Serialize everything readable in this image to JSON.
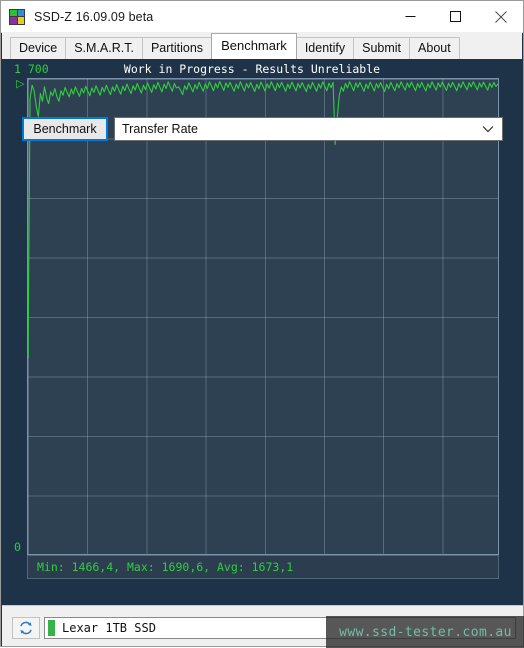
{
  "window": {
    "title": "SSD-Z 16.09.09 beta",
    "icon": "ssdz-app-icon",
    "controls": {
      "minimize": "minimize-icon",
      "maximize": "maximize-icon",
      "close": "close-icon"
    }
  },
  "tabs": [
    {
      "label": "Device",
      "active": false
    },
    {
      "label": "S.M.A.R.T.",
      "active": false
    },
    {
      "label": "Partitions",
      "active": false
    },
    {
      "label": "Benchmark",
      "active": true
    },
    {
      "label": "Identify",
      "active": false
    },
    {
      "label": "Submit",
      "active": false
    },
    {
      "label": "About",
      "active": false
    }
  ],
  "chart_data": {
    "type": "line",
    "title": "Work in Progress - Results Unreliable",
    "xlabel": "",
    "ylabel": "",
    "ylim": [
      0,
      1700
    ],
    "y_tick_labels": [
      "1 700",
      "0"
    ],
    "grid": true,
    "legend": false,
    "series_color": "#2ecf3e",
    "background": "#2e4152",
    "marker": "▷",
    "stats": {
      "min": "1466,4",
      "max": "1690,6",
      "avg": "1673,1",
      "text": "Min: 1466,4, Max: 1690,6, Avg: 1673,1"
    },
    "x": [
      0,
      1,
      2,
      3,
      4,
      5,
      6,
      7,
      8,
      9,
      10,
      11,
      12,
      13,
      14,
      15,
      16,
      17,
      18,
      19,
      20,
      21,
      22,
      23,
      24,
      25,
      26,
      27,
      28,
      29,
      30,
      31,
      32,
      33,
      34,
      35,
      36,
      37,
      38,
      39,
      40,
      41,
      42,
      43,
      44,
      45,
      46,
      47,
      48,
      49,
      50,
      51,
      52,
      53,
      54,
      55,
      56,
      57,
      58,
      59,
      60,
      61,
      62,
      63,
      64,
      65,
      66,
      67,
      68,
      69,
      70,
      71,
      72,
      73,
      74,
      75,
      76,
      77,
      78,
      79,
      80,
      81,
      82,
      83,
      84,
      85,
      86,
      87,
      88,
      89,
      90,
      91,
      92,
      93,
      94,
      95,
      96,
      97,
      98,
      99,
      100,
      101,
      102,
      103,
      104,
      105,
      106,
      107,
      108,
      109,
      110,
      111,
      112,
      113,
      114,
      115,
      116,
      117,
      118,
      119,
      120,
      121,
      122,
      123,
      124,
      125,
      126,
      127,
      128,
      129,
      130,
      131,
      132,
      133,
      134,
      135,
      136,
      137,
      138,
      139,
      140,
      141,
      142,
      143,
      144,
      145,
      146,
      147,
      148,
      149,
      150,
      151,
      152,
      153,
      154,
      155,
      156,
      157,
      158,
      159,
      160,
      161,
      162,
      163,
      164,
      165,
      166,
      167,
      168,
      169,
      170,
      171,
      172,
      173,
      174,
      175,
      176,
      177,
      178,
      179,
      180,
      181,
      182,
      183,
      184,
      185,
      186,
      187,
      188,
      189,
      190,
      191,
      192,
      193,
      194,
      195,
      196,
      197,
      198,
      199,
      200,
      201,
      202,
      203,
      204,
      205,
      206,
      207,
      208,
      209,
      210,
      211,
      212,
      213,
      214,
      215,
      216,
      217,
      218,
      219,
      220,
      221,
      222,
      223,
      224,
      225,
      226,
      227,
      228,
      229,
      230,
      231,
      232,
      233
    ],
    "values": [
      700,
      1630,
      1678,
      1656,
      1602,
      1566,
      1648,
      1620,
      1672,
      1634,
      1612,
      1654,
      1640,
      1666,
      1638,
      1620,
      1658,
      1642,
      1670,
      1652,
      1636,
      1664,
      1646,
      1672,
      1654,
      1638,
      1666,
      1650,
      1674,
      1656,
      1640,
      1668,
      1652,
      1676,
      1658,
      1642,
      1670,
      1654,
      1678,
      1660,
      1644,
      1672,
      1656,
      1680,
      1662,
      1646,
      1674,
      1658,
      1682,
      1664,
      1648,
      1676,
      1660,
      1684,
      1666,
      1650,
      1678,
      1662,
      1686,
      1668,
      1652,
      1680,
      1664,
      1688,
      1670,
      1654,
      1682,
      1666,
      1690,
      1672,
      1656,
      1684,
      1668,
      1672,
      1660,
      1644,
      1676,
      1662,
      1686,
      1670,
      1654,
      1680,
      1664,
      1688,
      1672,
      1656,
      1682,
      1666,
      1690,
      1674,
      1658,
      1684,
      1668,
      1691,
      1675,
      1659,
      1686,
      1670,
      1688,
      1672,
      1656,
      1682,
      1666,
      1690,
      1673,
      1657,
      1684,
      1668,
      1687,
      1671,
      1655,
      1681,
      1665,
      1689,
      1673,
      1657,
      1683,
      1667,
      1690,
      1674,
      1658,
      1685,
      1669,
      1688,
      1672,
      1656,
      1682,
      1666,
      1689,
      1673,
      1657,
      1684,
      1668,
      1687,
      1671,
      1655,
      1681,
      1665,
      1688,
      1672,
      1656,
      1683,
      1667,
      1690,
      1674,
      1658,
      1685,
      1669,
      1688,
      1466,
      1560,
      1640,
      1672,
      1656,
      1684,
      1668,
      1690,
      1674,
      1658,
      1686,
      1670,
      1688,
      1672,
      1656,
      1682,
      1666,
      1689,
      1673,
      1657,
      1684,
      1668,
      1687,
      1671,
      1655,
      1681,
      1665,
      1688,
      1672,
      1658,
      1684,
      1668,
      1690,
      1674,
      1660,
      1686,
      1670,
      1689,
      1673,
      1658,
      1684,
      1669,
      1688,
      1672,
      1657,
      1683,
      1668,
      1690,
      1675,
      1660,
      1686,
      1671,
      1689,
      1674,
      1659,
      1685,
      1670,
      1688,
      1673,
      1658,
      1684,
      1669,
      1690,
      1675,
      1661,
      1687,
      1672,
      1690,
      1675,
      1661,
      1686,
      1671,
      1689,
      1674,
      1660,
      1685,
      1670,
      1688,
      1673,
      1682
    ]
  },
  "controls": {
    "benchmark_button": "Benchmark",
    "mode_select": {
      "value": "Transfer Rate",
      "options": [
        "Transfer Rate"
      ],
      "arrow_icon": "chevron-down-icon"
    }
  },
  "statusbar": {
    "refresh_icon": "refresh-icon",
    "device_select": {
      "value": "Lexar 1TB SSD",
      "indicator_color": "#38b349"
    }
  },
  "watermark": {
    "text": "www.ssd-tester.com.au"
  }
}
